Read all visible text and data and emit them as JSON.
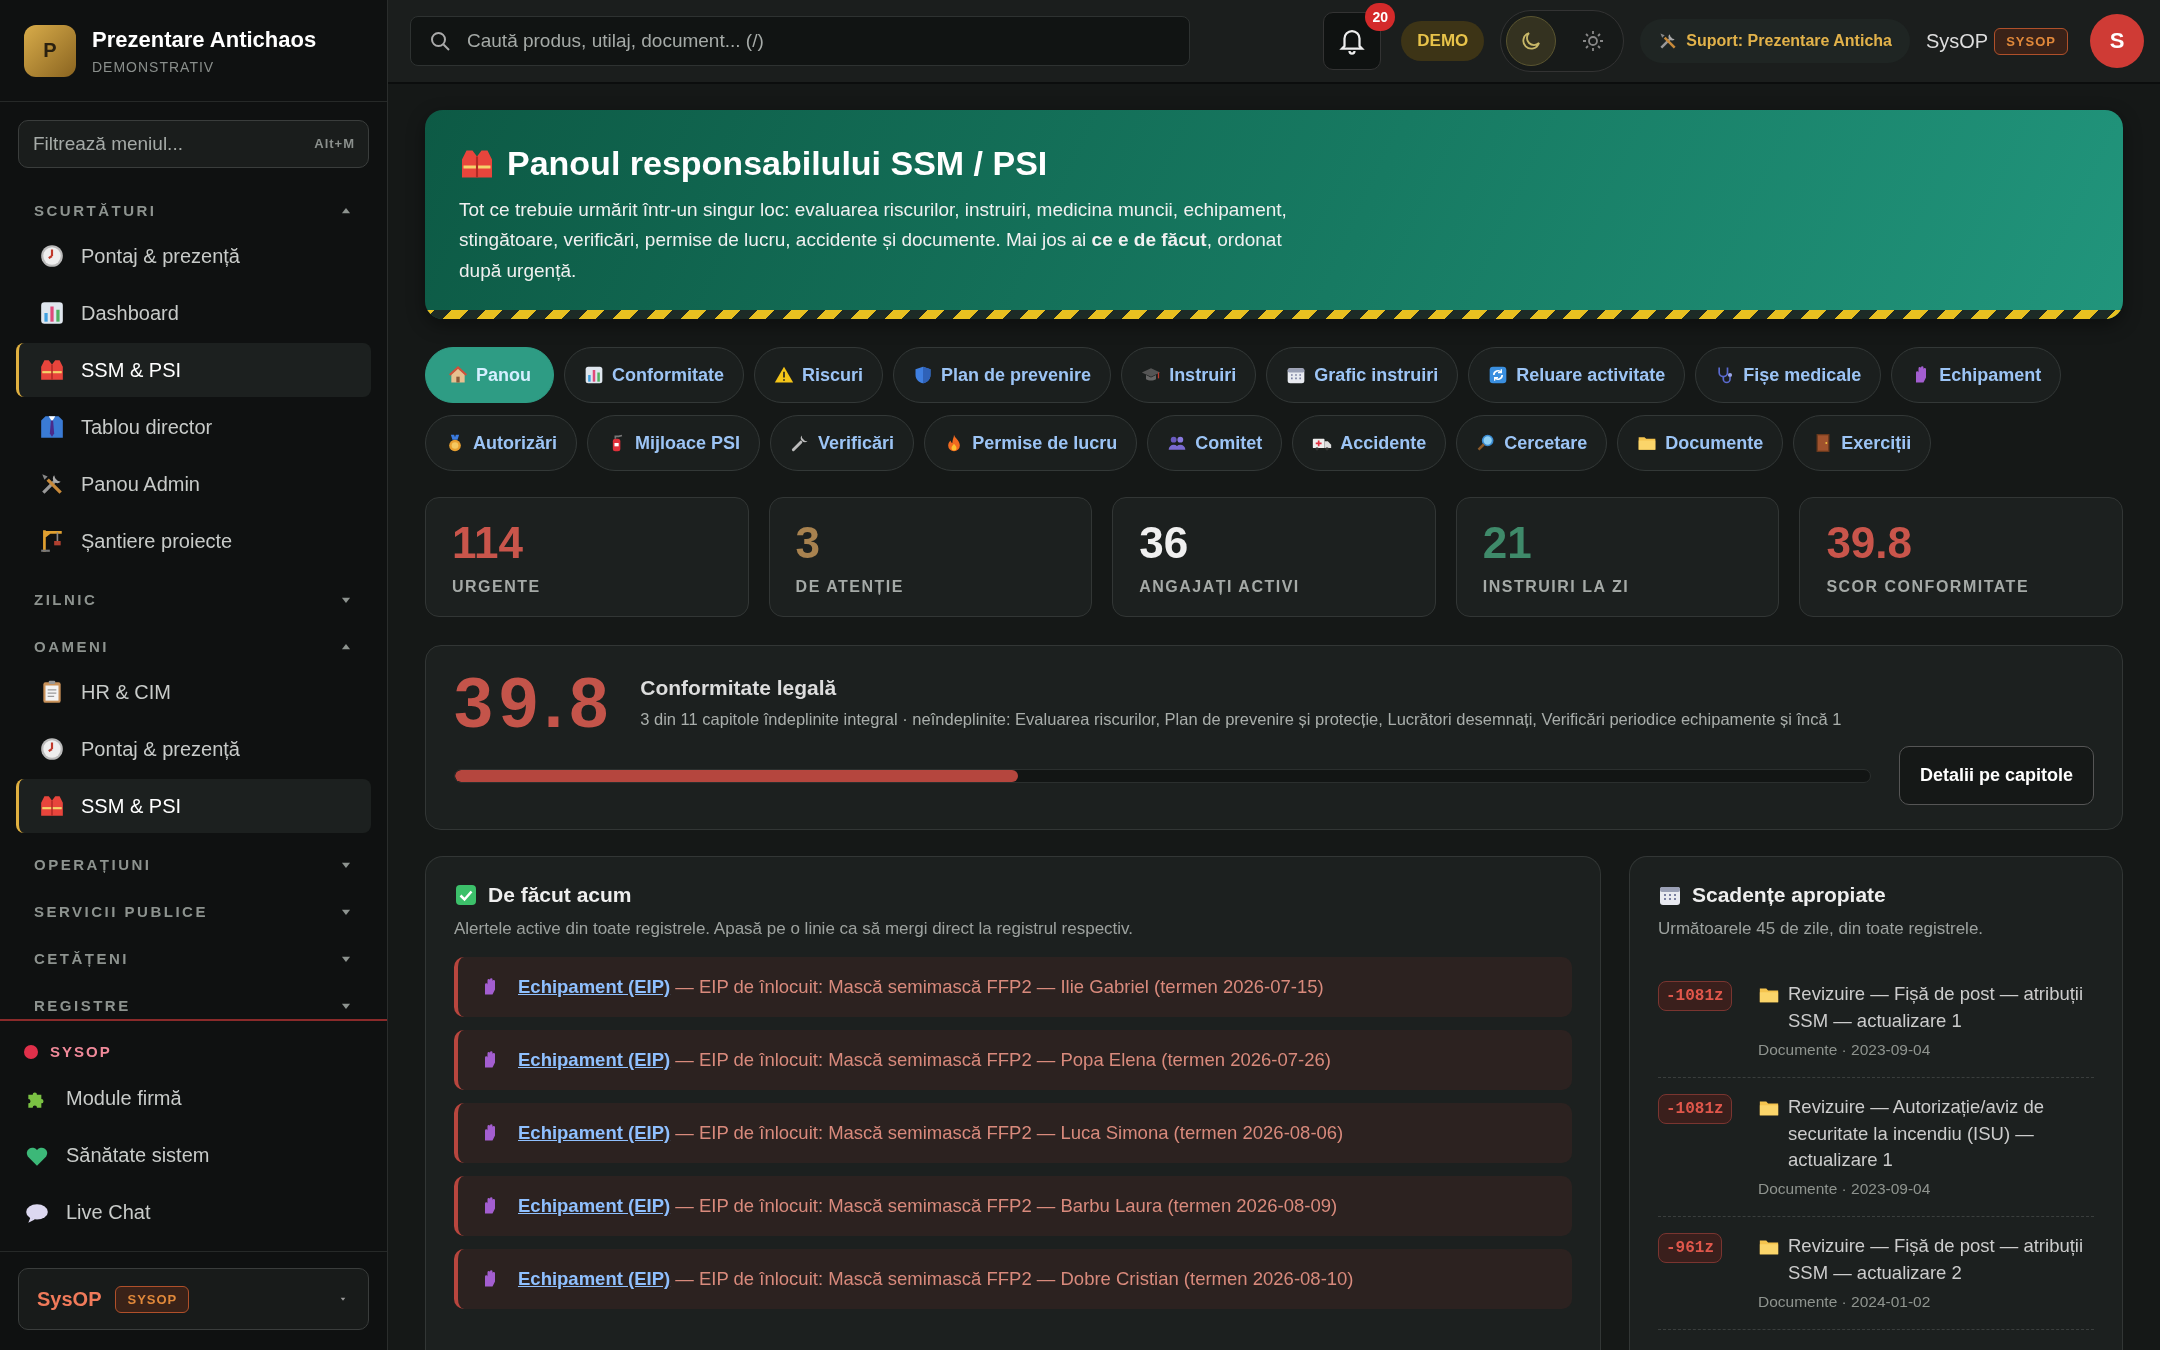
{
  "brand": {
    "initial": "P",
    "name": "Prezentare Antichaos",
    "subtitle": "DEMONSTRATIV"
  },
  "menu_filter": {
    "placeholder": "Filtrează meniul...",
    "shortcut": "Alt+M"
  },
  "sidebar": {
    "sections": [
      {
        "title": "SCURTĂTURI",
        "expanded": true,
        "items": [
          {
            "label": "Pontaj & prezență",
            "selected": false
          },
          {
            "label": "Dashboard",
            "selected": false
          },
          {
            "label": "SSM & PSI",
            "selected": true
          },
          {
            "label": "Tablou director",
            "selected": false
          },
          {
            "label": "Panou Admin",
            "selected": false
          },
          {
            "label": "Șantiere proiecte",
            "selected": false
          }
        ]
      },
      {
        "title": "ZILNIC",
        "expanded": false
      },
      {
        "title": "OAMENI",
        "expanded": true,
        "items": [
          {
            "label": "HR & CIM",
            "selected": false
          },
          {
            "label": "Pontaj & prezență",
            "selected": false
          },
          {
            "label": "SSM & PSI",
            "selected": true
          }
        ]
      },
      {
        "title": "OPERAȚIUNI",
        "expanded": false
      },
      {
        "title": "SERVICII PUBLICE",
        "expanded": false
      },
      {
        "title": "CETĂȚENI",
        "expanded": false
      },
      {
        "title": "REGISTRE",
        "expanded": false
      }
    ]
  },
  "sysop_section": {
    "title": "SYSOP",
    "items": [
      {
        "label": "Module firmă"
      },
      {
        "label": "Sănătate sistem"
      },
      {
        "label": "Live Chat"
      }
    ]
  },
  "user_menu": {
    "name": "SysOP",
    "role": "SYSOP"
  },
  "topbar": {
    "search": {
      "placeholder": "Caută produs, utilaj, document... (/)"
    },
    "notifications": "20",
    "mode_badge": "DEMO",
    "theme": [
      {
        "kind": "dark",
        "selected": true
      },
      {
        "kind": "light",
        "selected": false
      }
    ],
    "support": "Suport: Prezentare Anticha",
    "user": "SysOP",
    "role": "SYSOP",
    "avatar": "S"
  },
  "hero": {
    "title": "Panoul responsabilului SSM / PSI",
    "text": "Tot ce trebuie urmărit într-un singur loc: evaluarea riscurilor, instruiri, medicina muncii, echipament, stingătoare, verificări, permise de lucru, accidente și documente. Mai jos ai **ce e de făcut**, ordonat după urgență."
  },
  "tabs": [
    {
      "label": "Panou",
      "selected": true
    },
    {
      "label": "Conformitate",
      "selected": false
    },
    {
      "label": "Riscuri",
      "selected": false
    },
    {
      "label": "Plan de prevenire",
      "selected": false
    },
    {
      "label": "Instruiri",
      "selected": false
    },
    {
      "label": "Grafic instruiri",
      "selected": false
    },
    {
      "label": "Reluare activitate",
      "selected": false
    },
    {
      "label": "Fișe medicale",
      "selected": false
    },
    {
      "label": "Echipament",
      "selected": false
    },
    {
      "label": "Autorizări",
      "selected": false
    },
    {
      "label": "Mijloace PSI",
      "selected": false
    },
    {
      "label": "Verificări",
      "selected": false
    },
    {
      "label": "Permise de lucru",
      "selected": false
    },
    {
      "label": "Comitet",
      "selected": false
    },
    {
      "label": "Accidente",
      "selected": false
    },
    {
      "label": "Cercetare",
      "selected": false
    },
    {
      "label": "Documente",
      "selected": false
    },
    {
      "label": "Exerciții",
      "selected": false
    }
  ],
  "stats": [
    {
      "value": "114",
      "label": "URGENTE",
      "color": "#c9554b"
    },
    {
      "value": "3",
      "label": "DE ATENȚIE",
      "color": "#a8824f"
    },
    {
      "value": "36",
      "label": "ANGAJAȚI ACTIVI",
      "color": "#f0f0f0"
    },
    {
      "value": "21",
      "label": "INSTRUIRI LA ZI",
      "color": "#3f8a6a"
    },
    {
      "value": "39.8",
      "label": "SCOR CONFORMITATE",
      "color": "#c9554b"
    }
  ],
  "compliance": {
    "score": "39.8",
    "title": "Conformitate legală",
    "text": "3 din 11 capitole îndeplinite integral · neîndeplinite: Evaluarea riscurilor, Plan de prevenire și protecție, Lucrători desemnați, Verificări periodice echipamente și încă 1",
    "level": 0.398,
    "button": "Detalii pe capitole"
  },
  "todo": {
    "title": "De făcut acum",
    "subtitle": "Alertele active din toate registrele. Apasă pe o linie ca să mergi direct la registrul respectiv.",
    "items": [
      {
        "link": "Echipament (EIP)",
        "text": "— EIP de înlocuit: Mască semimască FFP2 — Ilie Gabriel (termen 2026-07-15)"
      },
      {
        "link": "Echipament (EIP)",
        "text": "— EIP de înlocuit: Mască semimască FFP2 — Popa Elena (termen 2026-07-26)"
      },
      {
        "link": "Echipament (EIP)",
        "text": "— EIP de înlocuit: Mască semimască FFP2 — Luca Simona (termen 2026-08-06)"
      },
      {
        "link": "Echipament (EIP)",
        "text": "— EIP de înlocuit: Mască semimască FFP2 — Barbu Laura (termen 2026-08-09)"
      },
      {
        "link": "Echipament (EIP)",
        "text": "— EIP de înlocuit: Mască semimască FFP2 — Dobre Cristian (termen 2026-08-10)"
      }
    ]
  },
  "deadlines": {
    "title": "Scadențe apropiate",
    "subtitle": "Următoarele 45 de zile, din toate registrele.",
    "items": [
      {
        "days": "-1081z",
        "title": "Revizuire — Fișă de post — atribuții SSM — actualizare 1",
        "meta": "Documente · 2023-09-04"
      },
      {
        "days": "-1081z",
        "title": "Revizuire — Autorizație/aviz de securitate la incendiu (ISU) — actualizare 1",
        "meta": "Documente · 2023-09-04"
      },
      {
        "days": "-961z",
        "title": "Revizuire — Fișă de post — atribuții SSM — actualizare 2",
        "meta": "Documente · 2024-01-02"
      }
    ]
  }
}
